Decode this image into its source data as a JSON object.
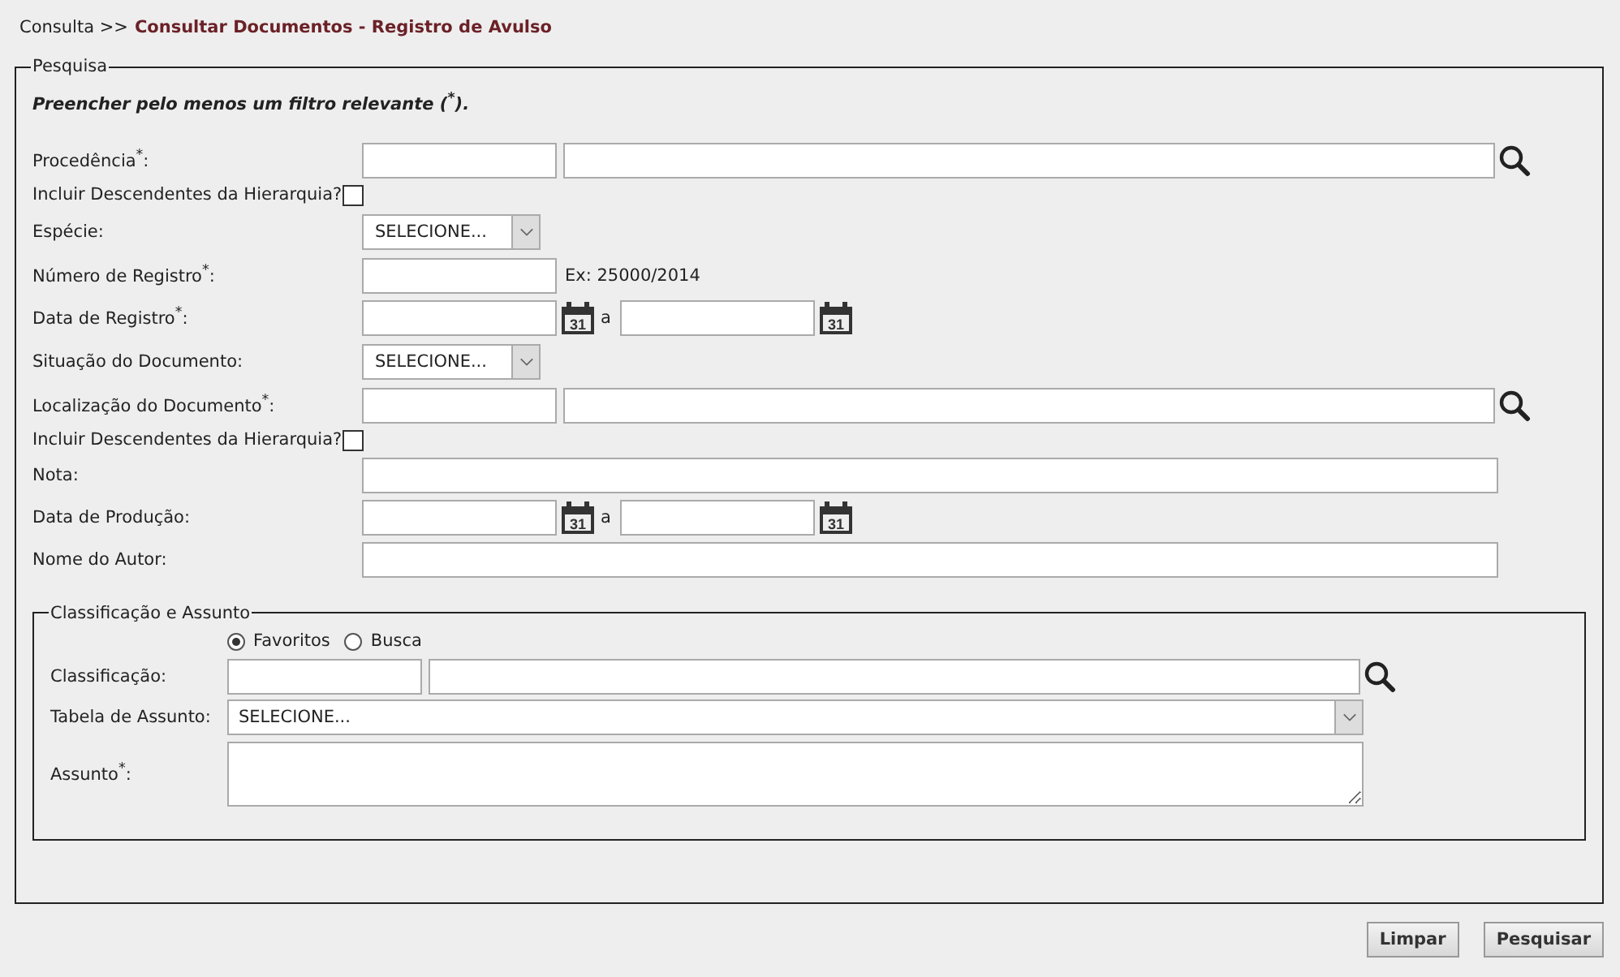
{
  "breadcrumb": {
    "parent": "Consulta >>",
    "current": "Consultar Documentos - Registro de Avulso"
  },
  "search": {
    "legend": "Pesquisa",
    "instruction": "Preencher pelo menos um filtro relevante ($^{*}$).",
    "fields": [
      {
        "kind": "lookup",
        "label": "Procedência$^{*}$:"
      },
      {
        "kind": "checkbox",
        "label": "Incluir Descendentes da Hierarquia?",
        "checked": false
      },
      {
        "kind": "select",
        "label": "Espécie:",
        "value": "SELECIONE..."
      },
      {
        "kind": "hint",
        "label": "Número de Registro$^{*}$:",
        "hint": "Ex: 25000/2014"
      },
      {
        "kind": "date_range",
        "label": "Data de Registro$^{*}$:",
        "separator": "a",
        "calendar_texts": [
          "31",
          "31"
        ]
      },
      {
        "kind": "select",
        "label": "Situação do Documento:",
        "value": "SELECIONE..."
      },
      {
        "kind": "lookup",
        "label": "Localização do Documento$^{*}$:"
      },
      {
        "kind": "checkbox",
        "label": "Incluir Descendentes da Hierarquia?",
        "checked": false
      },
      {
        "kind": "text",
        "label": "Nota:"
      },
      {
        "kind": "date_range",
        "label": "Data de Produção:",
        "separator": "a",
        "calendar_texts": [
          "31",
          "31"
        ]
      },
      {
        "kind": "text",
        "label": "Nome do Autor:"
      }
    ]
  },
  "classification": {
    "legend": "Classificação e Assunto",
    "options": [
      {
        "label": "Favoritos",
        "selected": true
      },
      {
        "label": "Busca",
        "selected": false
      }
    ],
    "classification_label": "Classificação:",
    "subject_table": {
      "label": "Tabela de Assunto:",
      "value": "SELECIONE..."
    },
    "subject": {
      "label": "Assunto$^{*}$:"
    }
  },
  "buttons": [
    "Limpar",
    "Pesquisar"
  ]
}
